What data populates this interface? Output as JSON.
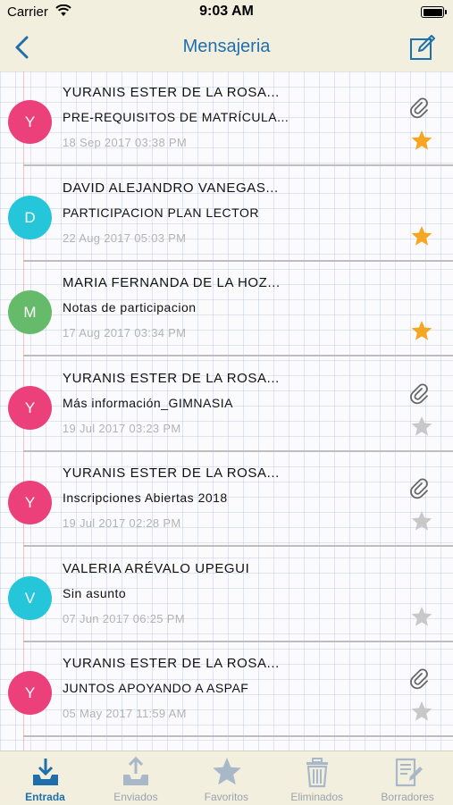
{
  "status_bar": {
    "carrier": "Carrier",
    "time": "9:03 AM"
  },
  "nav": {
    "title": "Mensajeria",
    "back_icon": "chevron-left-icon",
    "compose_icon": "compose-icon"
  },
  "colors": {
    "accent": "#1f6fad",
    "star_active": "#f5a623",
    "star_inactive": "#c8c8c8",
    "pink": "#ec407a",
    "cyan": "#26c6da",
    "green": "#66bb6a"
  },
  "messages": [
    {
      "initial": "Y",
      "avatar_color": "#ec407a",
      "sender": "YURANIS ESTER DE LA ROSA...",
      "subject": "PRE-REQUISITOS DE MATRÍCULA...",
      "date": "18 Sep 2017 03:38 PM",
      "attachment": true,
      "starred": true
    },
    {
      "initial": "D",
      "avatar_color": "#26c6da",
      "sender": "DAVID ALEJANDRO VANEGAS...",
      "subject": "PARTICIPACION PLAN LECTOR",
      "date": "22 Aug 2017 05:03 PM",
      "attachment": false,
      "starred": true
    },
    {
      "initial": "M",
      "avatar_color": "#66bb6a",
      "sender": "MARIA FERNANDA DE LA HOZ...",
      "subject": "Notas de participacion",
      "date": "17 Aug 2017 03:34 PM",
      "attachment": false,
      "starred": true
    },
    {
      "initial": "Y",
      "avatar_color": "#ec407a",
      "sender": "YURANIS ESTER DE LA ROSA...",
      "subject": "Más información_GIMNASIA",
      "date": "19 Jul 2017 03:23 PM",
      "attachment": true,
      "starred": false
    },
    {
      "initial": "Y",
      "avatar_color": "#ec407a",
      "sender": "YURANIS ESTER DE LA ROSA...",
      "subject": "Inscripciones Abiertas 2018",
      "date": "19 Jul 2017 02:28 PM",
      "attachment": true,
      "starred": false
    },
    {
      "initial": "V",
      "avatar_color": "#26c6da",
      "sender": "VALERIA ARÉVALO UPEGUI",
      "subject": "Sin asunto",
      "date": "07 Jun 2017 06:25 PM",
      "attachment": false,
      "starred": false
    },
    {
      "initial": "Y",
      "avatar_color": "#ec407a",
      "sender": "YURANIS ESTER DE LA ROSA...",
      "subject": "JUNTOS APOYANDO A ASPAF",
      "date": "05 May 2017 11:59 AM",
      "attachment": true,
      "starred": false
    }
  ],
  "tabs": [
    {
      "label": "Entrada",
      "icon": "inbox-download-icon",
      "active": true
    },
    {
      "label": "Enviados",
      "icon": "outbox-upload-icon",
      "active": false
    },
    {
      "label": "Favoritos",
      "icon": "star-icon",
      "active": false
    },
    {
      "label": "Eliminados",
      "icon": "trash-icon",
      "active": false
    },
    {
      "label": "Borradores",
      "icon": "draft-icon",
      "active": false
    }
  ]
}
